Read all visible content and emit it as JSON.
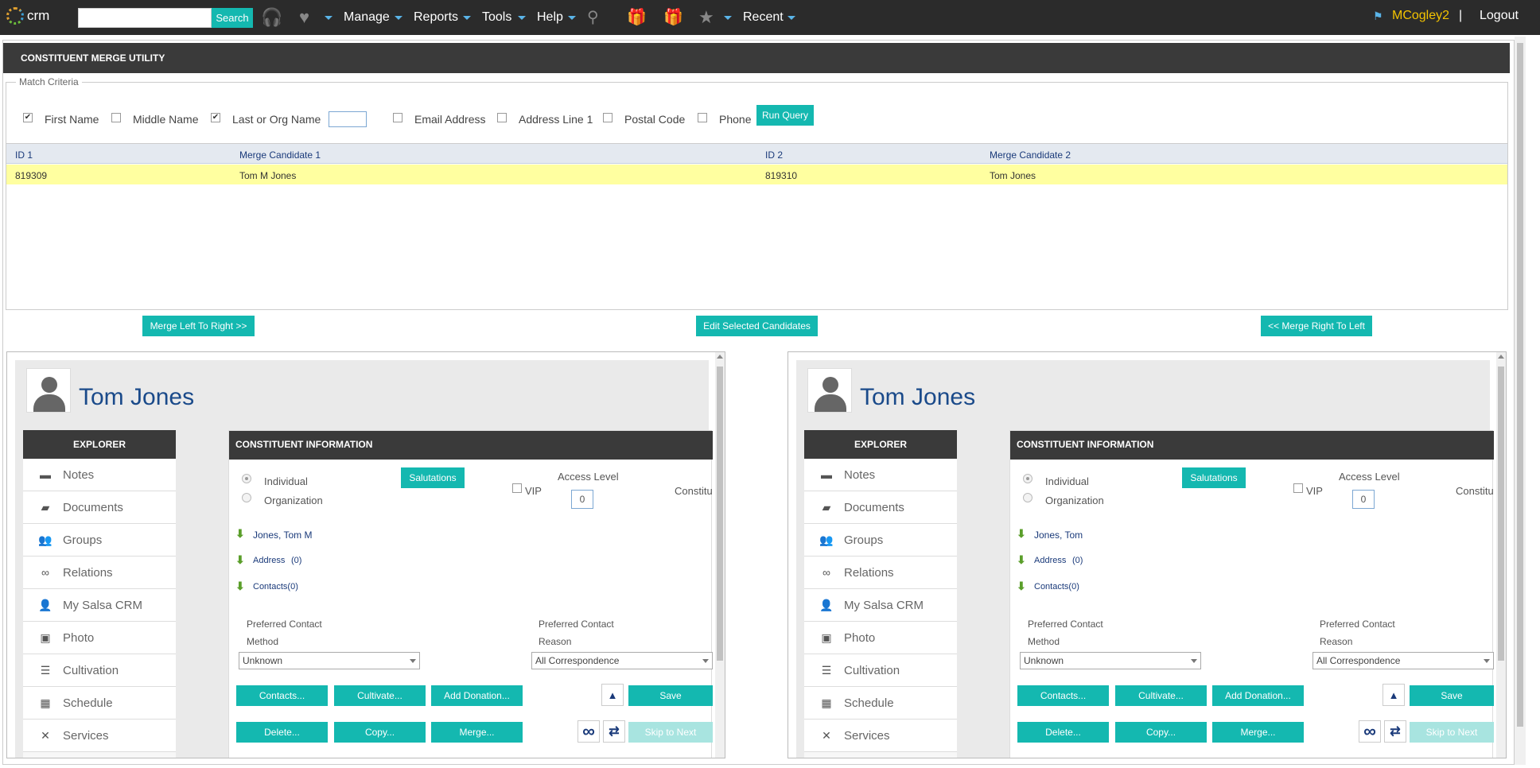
{
  "topbar": {
    "logo_text": "crm",
    "search_label": "Search",
    "menus": [
      "Manage",
      "Reports",
      "Tools",
      "Help",
      "Recent"
    ],
    "user": "MCogley2",
    "separator": "|",
    "logout": "Logout"
  },
  "utility": {
    "title": "CONSTITUENT MERGE UTILITY",
    "legend": "Match Criteria",
    "criteria": [
      {
        "label": "First Name",
        "checked": true
      },
      {
        "label": "Middle Name",
        "checked": false
      },
      {
        "label": "Last or Org Name",
        "checked": true
      },
      {
        "label": "Email Address",
        "checked": false
      },
      {
        "label": "Address Line 1",
        "checked": false
      },
      {
        "label": "Postal Code",
        "checked": false
      },
      {
        "label": "Phone",
        "checked": false
      }
    ],
    "run_query": "Run Query",
    "columns": [
      "ID 1",
      "Merge Candidate 1",
      "ID 2",
      "Merge Candidate 2"
    ],
    "rows": [
      {
        "id1": "819309",
        "cand1": "Tom M Jones",
        "id2": "819310",
        "cand2": "Tom Jones"
      }
    ],
    "merge_left_to_right": "Merge Left To Right >>",
    "edit_selected": "Edit Selected Candidates",
    "merge_right_to_left": "<< Merge Right To Left"
  },
  "panels": [
    {
      "name": "Tom Jones",
      "sort_name": "Jones, Tom M",
      "address": "Address",
      "address_count": "(0)",
      "contacts": "Contacts(0)",
      "access_level": "0",
      "method_value": "Unknown",
      "reason_value": "All Correspondence"
    },
    {
      "name": "Tom Jones",
      "sort_name": "Jones, Tom",
      "address": "Address",
      "address_count": "(0)",
      "contacts": "Contacts(0)",
      "access_level": "0",
      "method_value": "Unknown",
      "reason_value": "All Correspondence"
    }
  ],
  "explorer": {
    "title": "EXPLORER",
    "items": [
      {
        "label": "Notes",
        "icon": "notes-icon"
      },
      {
        "label": "Documents",
        "icon": "folder-icon"
      },
      {
        "label": "Groups",
        "icon": "groups-icon"
      },
      {
        "label": "Relations",
        "icon": "link-icon"
      },
      {
        "label": "My Salsa CRM",
        "icon": "user-chat-icon"
      },
      {
        "label": "Photo",
        "icon": "photo-icon"
      },
      {
        "label": "Cultivation",
        "icon": "list-icon"
      },
      {
        "label": "Schedule",
        "icon": "calendar-icon"
      },
      {
        "label": "Services",
        "icon": "tools-icon"
      }
    ]
  },
  "ci": {
    "title": "CONSTITUENT INFORMATION",
    "individual": "Individual",
    "organization": "Organization",
    "salutations": "Salutations",
    "vip": "VIP",
    "access_label": "Access Level",
    "constituent_cut": "Constitu",
    "pref_method_1": "Preferred Contact",
    "pref_method_2": "Method",
    "pref_reason_1": "Preferred Contact",
    "pref_reason_2": "Reason",
    "btn_contacts": "Contacts...",
    "btn_cultivate": "Cultivate...",
    "btn_add_donation": "Add Donation...",
    "btn_save": "Save",
    "btn_delete": "Delete...",
    "btn_copy": "Copy...",
    "btn_merge": "Merge...",
    "btn_skip": "Skip to Next",
    "infinity": "∞",
    "up_arrow": "▲",
    "repeat": "⇄"
  },
  "colors": {
    "accent": "#14b8b0",
    "highlight_row": "#ffffa0",
    "header": "#3a3a3a",
    "user": "#f3c300"
  }
}
